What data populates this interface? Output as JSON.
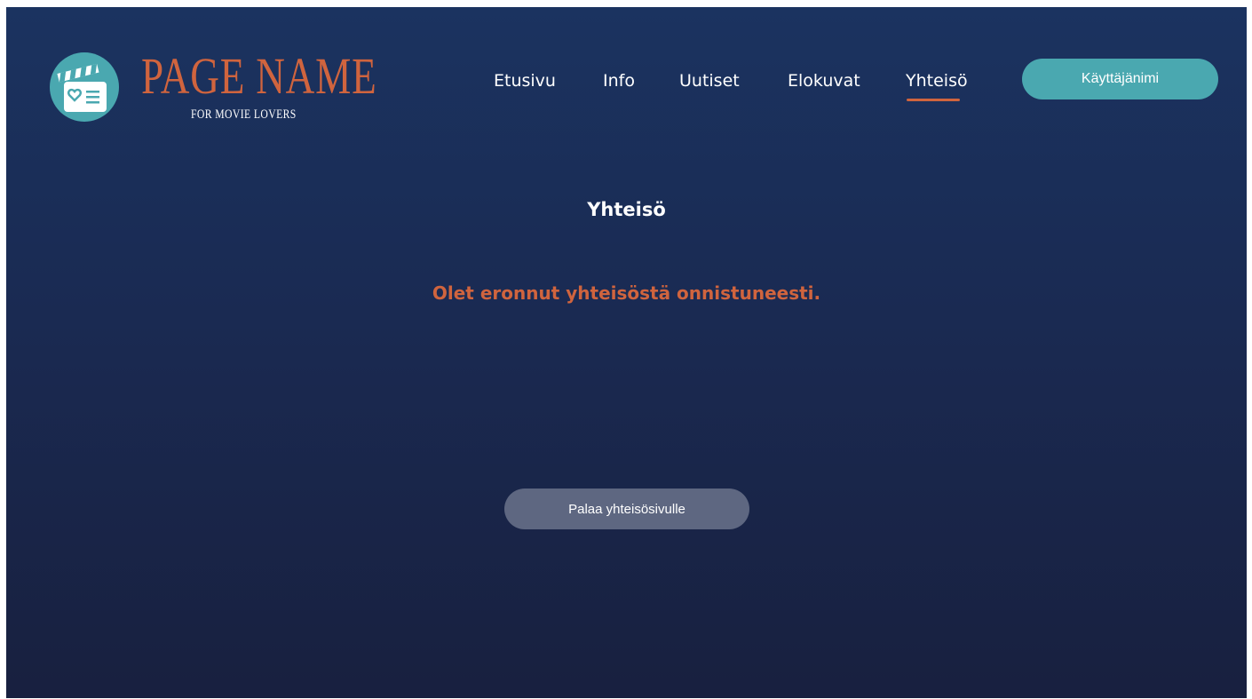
{
  "brand": {
    "name": "PAGE NAME",
    "tagline": "FOR MOVIE LOVERS",
    "logo_icon": "clapperboard-heart-icon"
  },
  "nav": {
    "items": [
      {
        "label": "Etusivu"
      },
      {
        "label": "Info"
      },
      {
        "label": "Uutiset"
      },
      {
        "label": "Elokuvat"
      },
      {
        "label": "Yhteisö",
        "active": true
      }
    ],
    "user_button": "Käyttäjänimi"
  },
  "main": {
    "title": "Yhteisö",
    "message": "Olet eronnut yhteisöstä onnistuneesti.",
    "back_button": "Palaa yhteisösivulle"
  },
  "colors": {
    "background_top": "#1b3360",
    "background_bottom": "#18203f",
    "accent_orange": "#d0643e",
    "accent_teal": "#4aa8b0",
    "secondary_button": "#5e6781"
  }
}
